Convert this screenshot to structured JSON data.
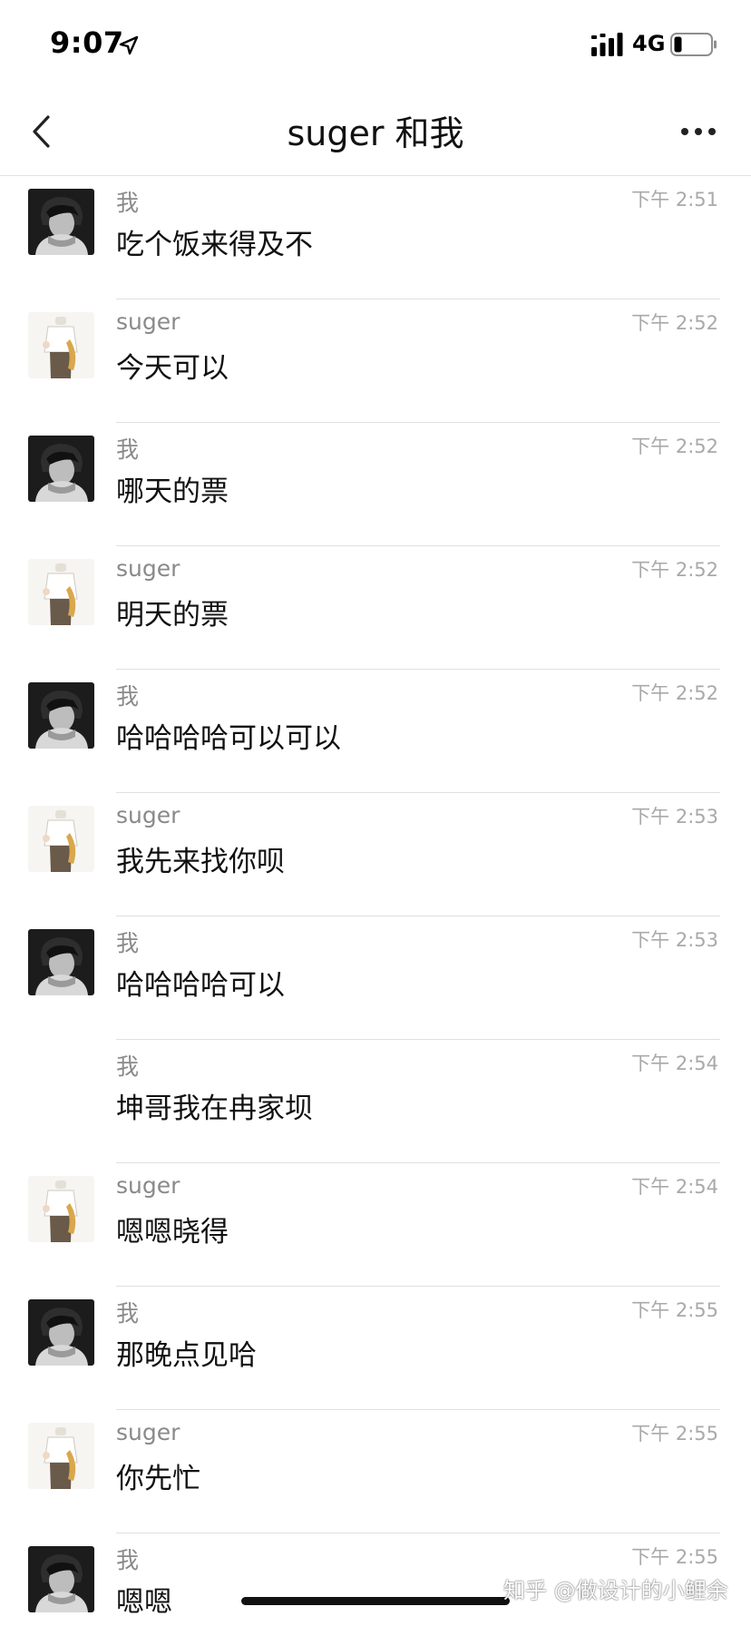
{
  "status_bar": {
    "time": "9:07",
    "network": "4G",
    "icons": [
      "location-arrow-icon",
      "cellular-signal-icon",
      "battery-icon"
    ]
  },
  "nav": {
    "title": "suger 和我",
    "icons": [
      "back-chevron-icon",
      "more-dots-icon"
    ]
  },
  "messages": [
    {
      "sender": "我",
      "time": "下午 2:51",
      "text": "吃个饭来得及不",
      "avatar": "me"
    },
    {
      "sender": "suger",
      "time": "下午 2:52",
      "text": "今天可以",
      "avatar": "suger"
    },
    {
      "sender": "我",
      "time": "下午 2:52",
      "text": "哪天的票",
      "avatar": "me"
    },
    {
      "sender": "suger",
      "time": "下午 2:52",
      "text": "明天的票",
      "avatar": "suger"
    },
    {
      "sender": "我",
      "time": "下午 2:52",
      "text": "哈哈哈哈可以可以",
      "avatar": "me"
    },
    {
      "sender": "suger",
      "time": "下午 2:53",
      "text": "我先来找你呗",
      "avatar": "suger"
    },
    {
      "sender": "我",
      "time": "下午 2:53",
      "text": "哈哈哈哈可以",
      "avatar": "me"
    },
    {
      "sender": "我",
      "time": "下午 2:54",
      "text": "坤哥我在冉家坝",
      "avatar": "none"
    },
    {
      "sender": "suger",
      "time": "下午 2:54",
      "text": "嗯嗯晓得",
      "avatar": "suger"
    },
    {
      "sender": "我",
      "time": "下午 2:55",
      "text": "那晚点见哈",
      "avatar": "me"
    },
    {
      "sender": "suger",
      "time": "下午 2:55",
      "text": "你先忙",
      "avatar": "suger"
    },
    {
      "sender": "我",
      "time": "下午 2:55",
      "text": "嗯嗯",
      "avatar": "me"
    }
  ],
  "watermark": "知乎 @做设计的小鲤余",
  "colors": {
    "sender": "#8a8a8a",
    "time": "#a9a9a9",
    "text": "#111111",
    "divider": "#e0e0e0"
  }
}
